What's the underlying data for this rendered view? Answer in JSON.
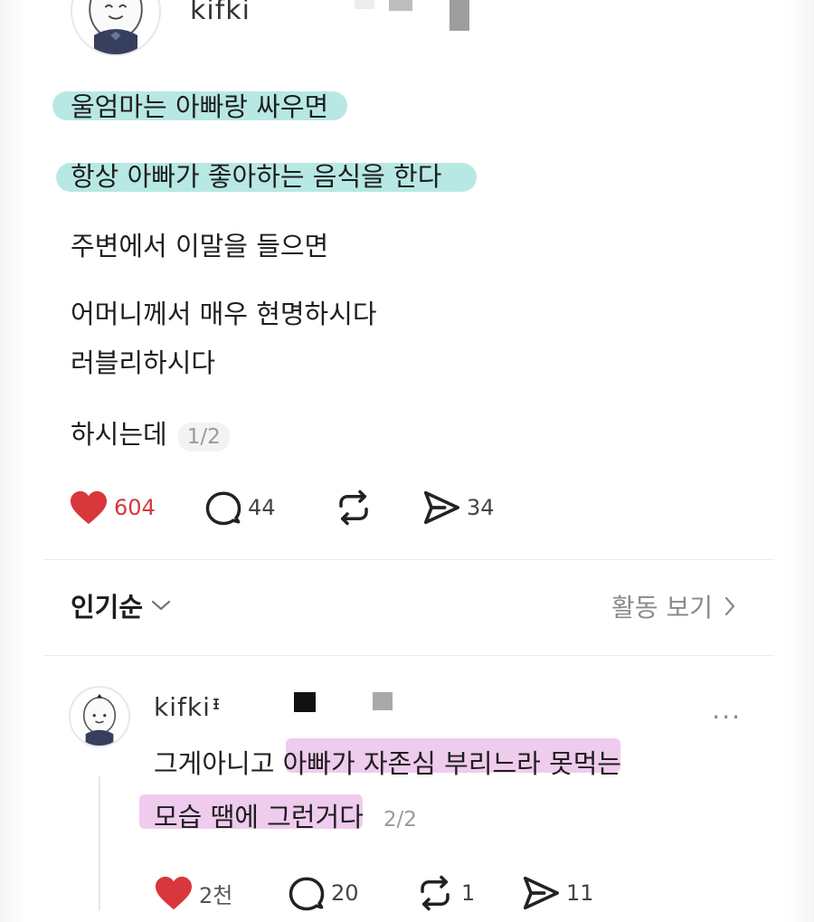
{
  "post": {
    "username": "kifki",
    "lines": [
      "울엄마는 아빠랑 싸우면",
      "항상 아빠가 좋아하는 음식을 한다",
      "주변에서 이말을 들으면",
      "어머니께서 매우 현명하시다",
      "러블리하시다",
      "하시는데"
    ],
    "page_indicator": "1/2",
    "actions": {
      "likes": "604",
      "comments": "44",
      "sends": "34"
    }
  },
  "sort": {
    "label": "인기순",
    "activity_link": "활동 보기"
  },
  "reply": {
    "username": "kifki",
    "verify_mark": "ᵻ",
    "lines": [
      "그게아니고 아빠가 자존심 부리느라 못먹는",
      "모습 땜에 그런거다"
    ],
    "page_indicator": "2/2",
    "more": "...",
    "actions": {
      "likes": "2천",
      "comments": "20",
      "reposts": "1",
      "sends": "11"
    }
  },
  "colors": {
    "like": "#d8373b",
    "teal_highlight": "#7cd6cd",
    "pink_highlight": "#e2a0de"
  }
}
